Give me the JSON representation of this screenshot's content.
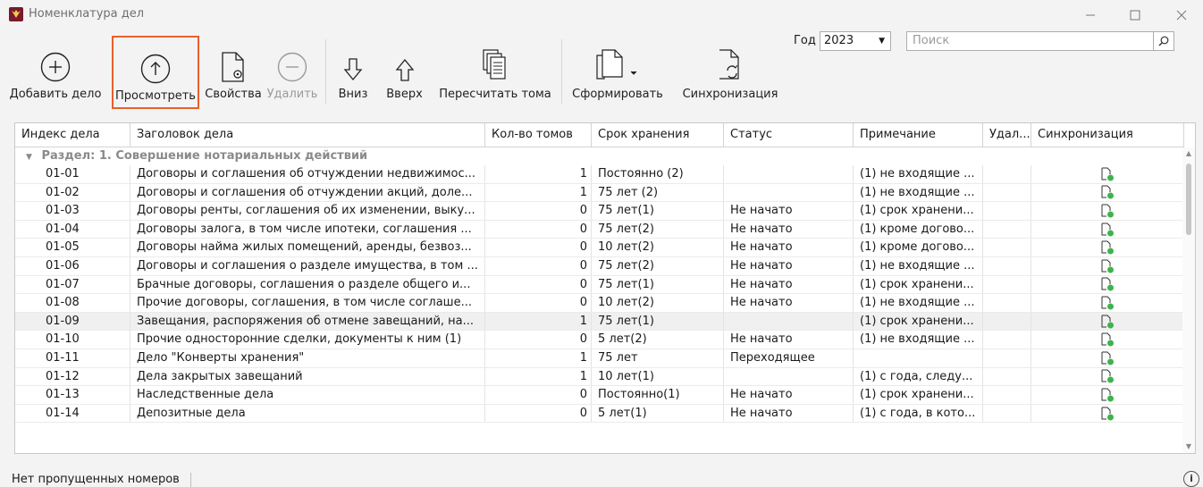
{
  "window": {
    "title": "Номенклатура дел"
  },
  "toolbar": {
    "add": "Добавить дело",
    "view": "Просмотреть",
    "properties": "Свойства",
    "delete": "Удалить",
    "down": "Вниз",
    "up": "Вверх",
    "recount": "Пересчитать тома",
    "form": "Сформировать",
    "sync": "Синхронизация"
  },
  "year": {
    "label": "Год",
    "value": "2023"
  },
  "search": {
    "placeholder": "Поиск"
  },
  "table": {
    "columns": [
      "Индекс дела",
      "Заголовок дела",
      "Кол-во томов",
      "Срок хранения",
      "Статус",
      "Примечание",
      "Удал...",
      "Синхронизация"
    ],
    "group": "Раздел: 1. Совершение нотариальных действий",
    "rows": [
      [
        "01-01",
        "Договоры и соглашения об отчуждении недвижимос...",
        "1",
        "Постоянно (2)",
        "",
        "(1) не входящие ..."
      ],
      [
        "01-02",
        "Договоры и соглашения об отчуждении акций, доле...",
        "1",
        "75 лет (2)",
        "",
        "(1) не входящие ..."
      ],
      [
        "01-03",
        "Договоры ренты, соглашения об их изменении, выку...",
        "0",
        "75 лет(1)",
        "Не начато",
        "(1) срок хранени..."
      ],
      [
        "01-04",
        "Договоры залога, в том числе ипотеки, соглашения ...",
        "0",
        "75 лет(2)",
        "Не начато",
        "(1) кроме догово..."
      ],
      [
        "01-05",
        "Договоры найма жилых помещений, аренды, безвоз...",
        "0",
        "10 лет(2)",
        "Не начато",
        "(1) кроме догово..."
      ],
      [
        "01-06",
        "Договоры и соглашения о разделе имущества, в том ...",
        "0",
        "75 лет(2)",
        "Не начато",
        "(1) не входящие ..."
      ],
      [
        "01-07",
        "Брачные договоры, соглашения о разделе общего и...",
        "0",
        "75 лет(1)",
        "Не начато",
        "(1) срок хранени..."
      ],
      [
        "01-08",
        "Прочие договоры, соглашения, в том числе соглаше...",
        "0",
        "10 лет(2)",
        "Не начато",
        "(1) не входящие ..."
      ],
      [
        "01-09",
        "Завещания, распоряжения об отмене завещаний, на...",
        "1",
        "75 лет(1)",
        "",
        "(1) срок хранени..."
      ],
      [
        "01-10",
        "Прочие односторонние сделки, документы к ним (1)",
        "0",
        "5 лет(2)",
        "Не начато",
        "(1) не входящие ..."
      ],
      [
        "01-11",
        "Дело \"Конверты хранения\"",
        "1",
        "75 лет",
        "Переходящее",
        ""
      ],
      [
        "01-12",
        "Дела закрытых завещаний",
        "1",
        "10 лет(1)",
        "",
        "(1) с года, следу..."
      ],
      [
        "01-13",
        "Наследственные дела",
        "0",
        "Постоянно(1)",
        "Не начато",
        "(1) срок хранени..."
      ],
      [
        "01-14",
        "Депозитные дела",
        "0",
        "5 лет(1)",
        "Не начато",
        "(1) с года, в кото..."
      ]
    ]
  },
  "status": {
    "text": "Нет пропущенных номеров",
    "info": "i"
  },
  "colors": {
    "accent": "#e8602c",
    "sync_green": "#3cb44b",
    "app_icon": "#7a1a2c"
  }
}
